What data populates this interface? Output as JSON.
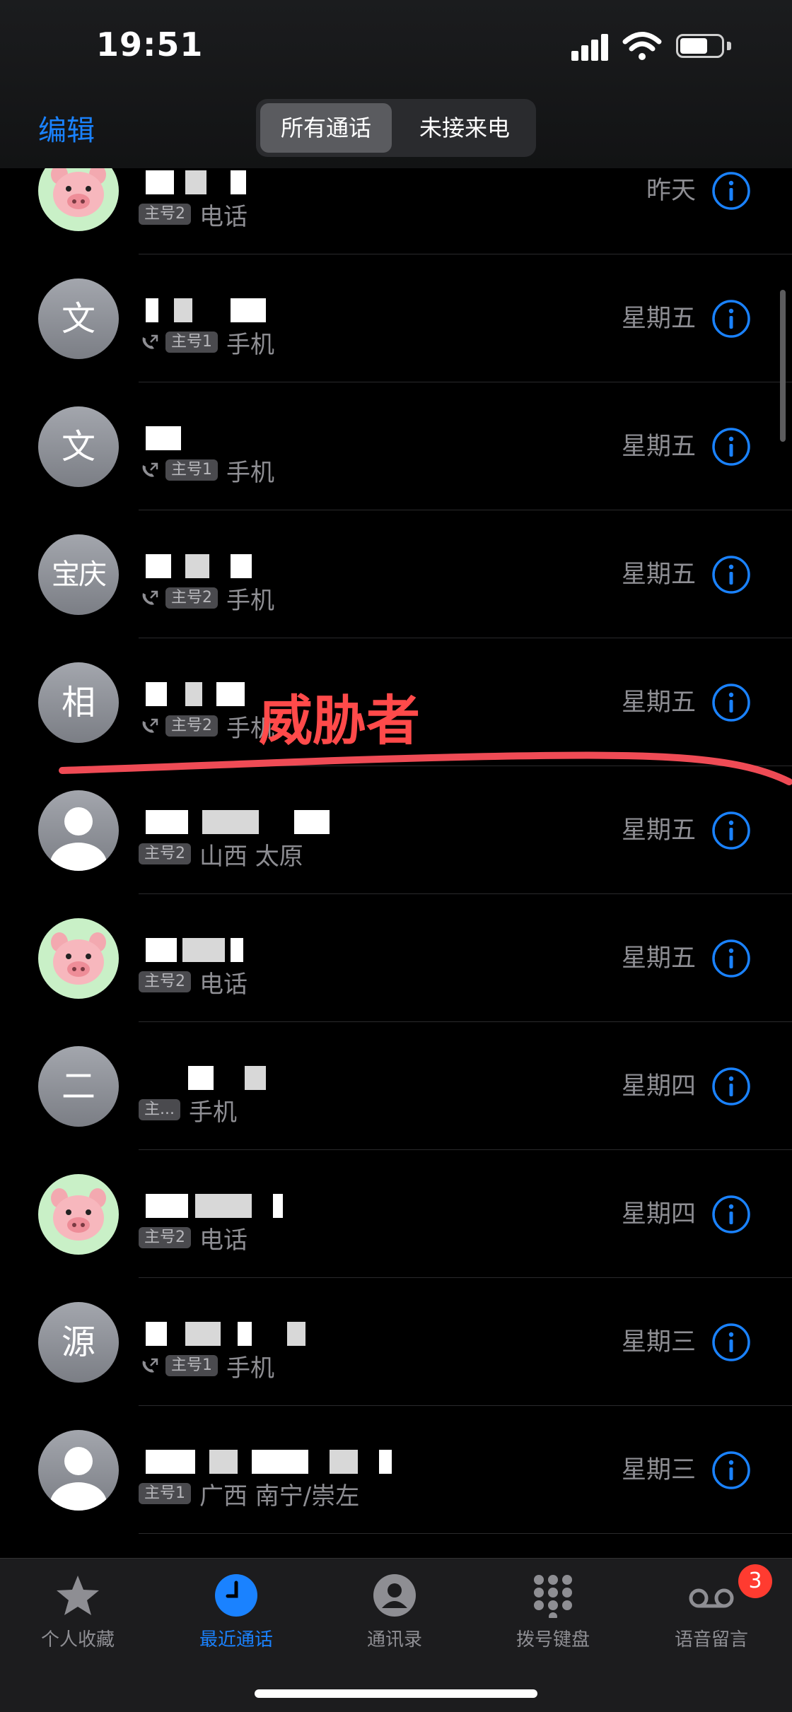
{
  "status_bar": {
    "time": "19:51"
  },
  "header": {
    "edit_label": "编辑",
    "segments": [
      "所有通话",
      "未接来电"
    ],
    "active_segment": "所有通话"
  },
  "calls": [
    {
      "avatar": "pig",
      "avatar_text": "",
      "outgoing": false,
      "sim": "主号2",
      "label": "电话",
      "date": "昨天"
    },
    {
      "avatar": "text",
      "avatar_text": "文",
      "outgoing": true,
      "sim": "主号1",
      "label": "手机",
      "date": "星期五"
    },
    {
      "avatar": "text",
      "avatar_text": "文",
      "outgoing": true,
      "sim": "主号1",
      "label": "手机",
      "date": "星期五"
    },
    {
      "avatar": "text",
      "avatar_text": "宝庆",
      "outgoing": true,
      "sim": "主号2",
      "label": "手机",
      "date": "星期五"
    },
    {
      "avatar": "text",
      "avatar_text": "相",
      "outgoing": true,
      "sim": "主号2",
      "label": "手机",
      "date": "星期五"
    },
    {
      "avatar": "person",
      "avatar_text": "",
      "outgoing": false,
      "sim": "主号2",
      "label": "山西 太原",
      "date": "星期五"
    },
    {
      "avatar": "pig",
      "avatar_text": "",
      "outgoing": false,
      "sim": "主号2",
      "label": "电话",
      "date": "星期五"
    },
    {
      "avatar": "text",
      "avatar_text": "二",
      "outgoing": false,
      "sim": "主...",
      "label": "手机",
      "date": "星期四"
    },
    {
      "avatar": "pig",
      "avatar_text": "",
      "outgoing": false,
      "sim": "主号2",
      "label": "电话",
      "date": "星期四"
    },
    {
      "avatar": "text",
      "avatar_text": "源",
      "outgoing": true,
      "sim": "主号1",
      "label": "手机",
      "date": "星期三"
    },
    {
      "avatar": "person",
      "avatar_text": "",
      "outgoing": false,
      "sim": "主号1",
      "label": "广西 南宁/崇左",
      "date": "星期三"
    }
  ],
  "annotation": {
    "text": "威胁者",
    "color": "#ff4a4a"
  },
  "tab_bar": {
    "tabs": [
      "个人收藏",
      "最近通话",
      "通讯录",
      "拨号键盘",
      "语音留言"
    ],
    "active": "最近通话",
    "voicemail_badge": "3"
  },
  "colors": {
    "accent": "#1a82ff",
    "secondary_text": "#8e8e93",
    "badge_red": "#ff3b30"
  },
  "icons": {
    "favorites": "star-icon",
    "recents": "clock-icon",
    "contacts": "person-circle-icon",
    "keypad": "keypad-icon",
    "voicemail": "voicemail-icon",
    "info": "info-circle-icon",
    "outgoing": "outgoing-call-icon"
  }
}
